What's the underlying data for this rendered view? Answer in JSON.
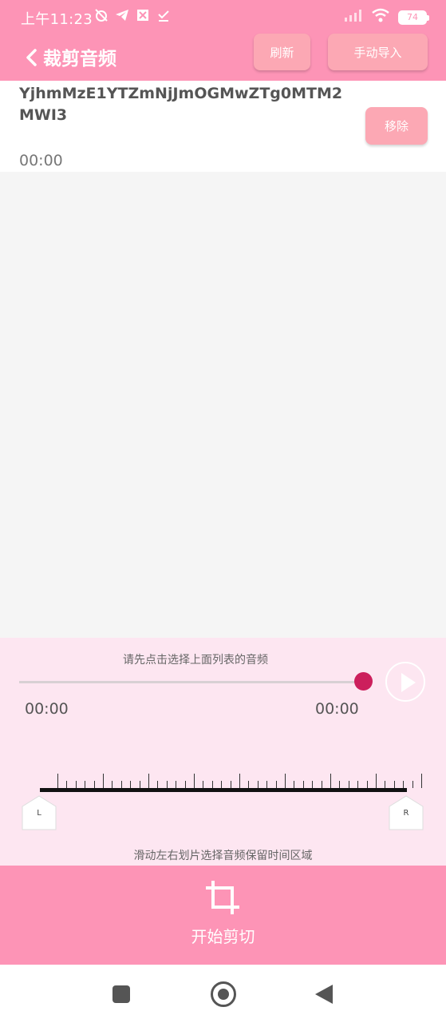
{
  "status_bar": {
    "time": "上午11:23",
    "battery": "74"
  },
  "toolbar": {
    "title": "裁剪音频",
    "refresh_label": "刷新",
    "import_label": "手动导入"
  },
  "audio_list": {
    "items": [
      {
        "name": "YjhmMzE1YTZmNjJmOGMwZTg0MTM2MWI3",
        "duration": "00:00",
        "remove_label": "移除"
      }
    ]
  },
  "player": {
    "hint": "请先点击选择上面列表的音频",
    "start_time": "00:00",
    "end_time": "00:00",
    "seek_progress": 1.0,
    "range_hint": "滑动左右划片选择音频保留时间区域",
    "left_handle_label": "L",
    "right_handle_label": "R"
  },
  "cut_action": {
    "label": "开始剪切"
  },
  "colors": {
    "header": "#fd94b6",
    "button": "#fca8b4",
    "player_bg": "#fde6f1",
    "seek_thumb": "#cc1f5c"
  }
}
